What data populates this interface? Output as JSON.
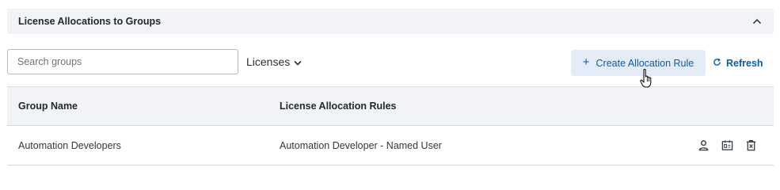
{
  "section": {
    "title": "License Allocations to Groups"
  },
  "toolbar": {
    "search_placeholder": "Search groups",
    "licenses_label": "Licenses",
    "create_label": "Create Allocation Rule",
    "refresh_label": "Refresh"
  },
  "table": {
    "columns": [
      "Group Name",
      "License Allocation Rules"
    ],
    "rows": [
      {
        "group_name": "Automation Developers",
        "rule": "Automation Developer - Named User",
        "actions": [
          "user-icon",
          "license-card-icon",
          "delete-icon"
        ]
      }
    ]
  },
  "colors": {
    "accent": "#0b5cad",
    "header_bg": "#f1f3f6",
    "button_bg": "#e4ecf7"
  }
}
